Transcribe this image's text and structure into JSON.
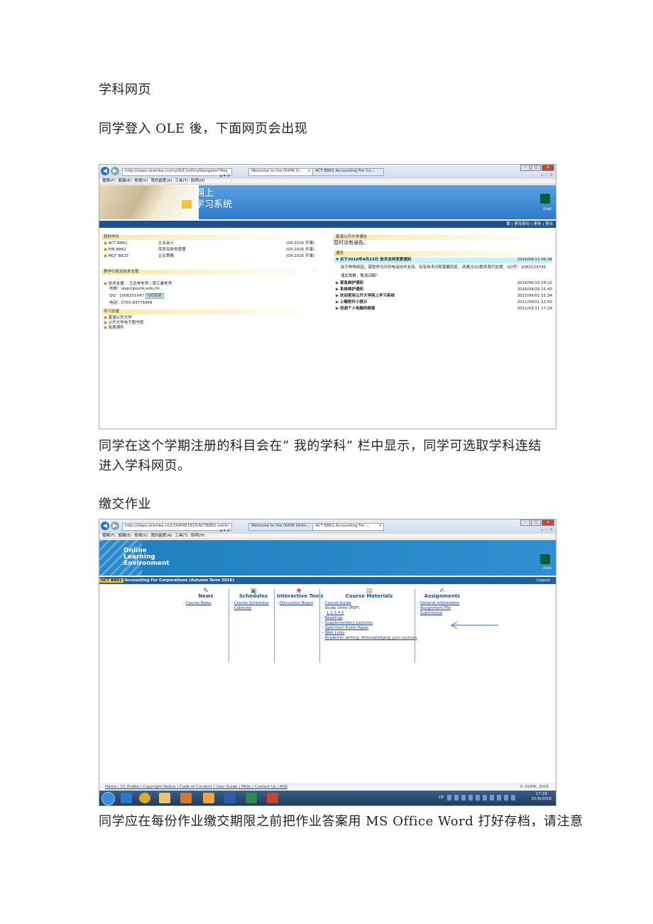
{
  "doc": {
    "heading1": "学科网页",
    "para_login": "同学登入 OLE 後，下面网页会出现",
    "para_subjects_line1": "同学在这个学期注册的科目会在”  我的学科”  栏中显示，同学可选取学科连结",
    "para_subjects_line2": "进入学科网页。",
    "heading2": "缴交作业",
    "para_assign": "同学应在每份作业缴交期限之前把作业答案用 MS Office Word 打好存档，请注意"
  },
  "shot1": {
    "address": "http://olepc.eramba.cn/myOLE.nsf/myNavigator?Rea",
    "address_tools": "ρ ▾ ↺",
    "tab1": "Welcome to the OUHK O...",
    "tab1_close": "×",
    "tab2": "ACT B861 Accounting For Co...",
    "menu": [
      "檔案(F)",
      "編輯(E)",
      "檢視(V)",
      "我的最愛(A)",
      "工具(T)",
      "說明(H)"
    ],
    "banner_line1": "网上",
    "banner_line2": "学习系统",
    "logo_text": "OUHK",
    "toplinks": "繁 | 更改密码 | 更新 | 登出",
    "left": {
      "my_subjects_head": "我的学科",
      "subjects": [
        {
          "code": "ACT B861",
          "name": "企业会计",
          "term": "(09-2016 开课)"
        },
        {
          "code": "FIN B862",
          "name": "库务及财务管理",
          "term": "(09-2016 开课)"
        },
        {
          "code": "MGT B820",
          "name": "企业策略",
          "term": "(09-2016 开课)"
        }
      ],
      "support_head": "教学行政及技术支援",
      "support_dash": "-",
      "support_lines": [
        "技术支援： 王达林老师 / 梁江春老师",
        "电邮：olepc@ouhk.edu.hk",
        "QQ：1006251047",
        "电话：0755-83775849"
      ],
      "qq_badge": "QQ交谈",
      "study_head": "学习支援",
      "study_links": [
        "香港公开大学",
        "公开大学电子图书馆",
        "免费课件"
      ]
    },
    "right": {
      "ouhk_head": "香港公开大学通告",
      "no_notice": "暂时没有通告。",
      "notice_head": "通告",
      "notices": [
        {
          "title": "关于2016年9月23日 技术支持变更通知",
          "date": "2016/09/13 06:34"
        },
        {
          "title": "紧急维护通知",
          "date": "2016/06/13 09:22"
        },
        {
          "title": "系统维护通知",
          "date": "2016/04/29 15:40"
        },
        {
          "title": "欢迎使用公开大学网上学习系统",
          "date": "2015/09/01 15:34"
        },
        {
          "title": "上载附件小提示",
          "date": "2011/04/21 12:50"
        },
        {
          "title": "侦测个人电脑的病毒",
          "date": "2011/03/11 17:29"
        }
      ],
      "notice_body": "由于种种原因，需暂停当日的电话技术支持，如有技术问题需要回复，请通过QQ联系我们处理，QQ号：2060133749",
      "notice_sign": "谨此致歉，敬请谅解！"
    }
  },
  "shot2": {
    "address": "http://olepc.eramba.cn/COURSE1615/ACTB861.nsf/m",
    "address_tools": "ρ ▾ ↺",
    "tab1": "Welcome to the OUHK Onlin...",
    "tab2": "ACT B861 Accounting For ...",
    "tab2_close": "×",
    "menu": [
      "檔案(F)",
      "編輯(E)",
      "檢視(V)",
      "我的最愛(A)",
      "工具(T)",
      "說明(H)"
    ],
    "banner": [
      "Online",
      "Learning",
      "Environment"
    ],
    "logo_text": "OUHK",
    "course_code": "ACT B861",
    "course_title": "Accounting For Corporations (Autumn Term 2016)",
    "logout": "Logout",
    "columns": [
      {
        "title": "News",
        "items": [
          "Course News"
        ]
      },
      {
        "title": "Schedules",
        "items": [
          "Course Schedules",
          "Calendar"
        ]
      },
      {
        "title": "Interactive Tools",
        "items": [
          "Discussion Board"
        ]
      },
      {
        "title": "Course Materials",
        "items": [
          "Course Guide",
          "Study Units (PDF)",
          "1 2 3 4 5",
          "Readings",
          "Supplementary Lectures",
          "Specimen Exam Paper",
          "Web Links",
          "Academic writing: Acknowledging your sources"
        ]
      },
      {
        "title": "Assignments",
        "items": [
          "General Information",
          "Assignment File",
          "Submission"
        ]
      }
    ],
    "footer_links": "Home | CC Profile | Copyright Notice | Code of Conduct | User Guide | FAQs | Contact Us | RSS",
    "footer_copy": "© OUHK, 2016",
    "tray_lang": "CE",
    "clock_time": "17:29",
    "clock_date": "21/9/2016"
  }
}
